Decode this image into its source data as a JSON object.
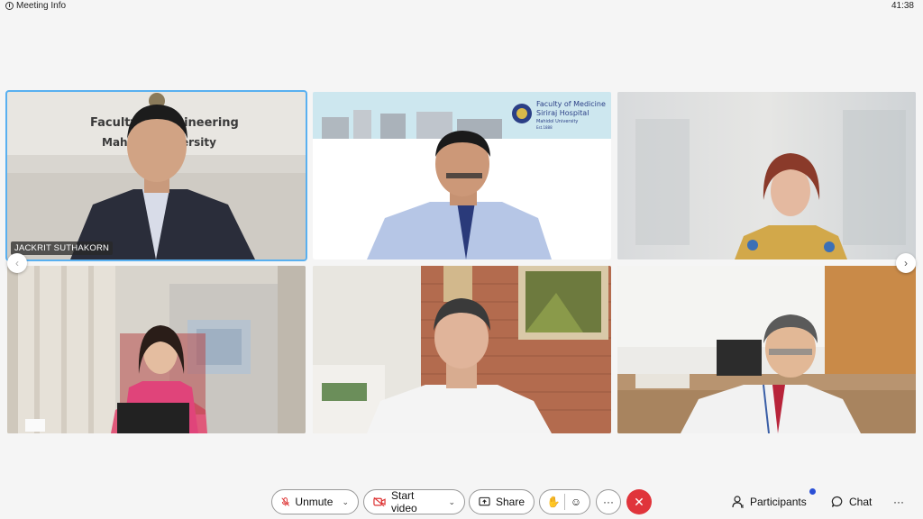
{
  "topbar": {
    "meeting_info": "Meeting Info",
    "clock": "41:38"
  },
  "tiles": [
    {
      "name": "JACKRIT SUTHAKORN",
      "sign_line1": "Faculty of Engineering",
      "sign_line2": "Mahidol University"
    },
    {
      "name": "",
      "logo_line1": "Faculty of Medicine",
      "logo_line2": "Siriraj Hospital",
      "logo_line3": "Mahidol University",
      "logo_line4": "Est.1888"
    },
    {
      "name": ""
    },
    {
      "name": ""
    },
    {
      "name": ""
    },
    {
      "name": ""
    }
  ],
  "controls": {
    "unmute": "Unmute",
    "start_video": "Start video",
    "share": "Share",
    "more": "···",
    "participants": "Participants",
    "chat": "Chat",
    "overflow": "···"
  },
  "colors": {
    "end_call": "#e0343b",
    "active_speaker": "#59b0f0",
    "notification": "#2a4fd6"
  }
}
